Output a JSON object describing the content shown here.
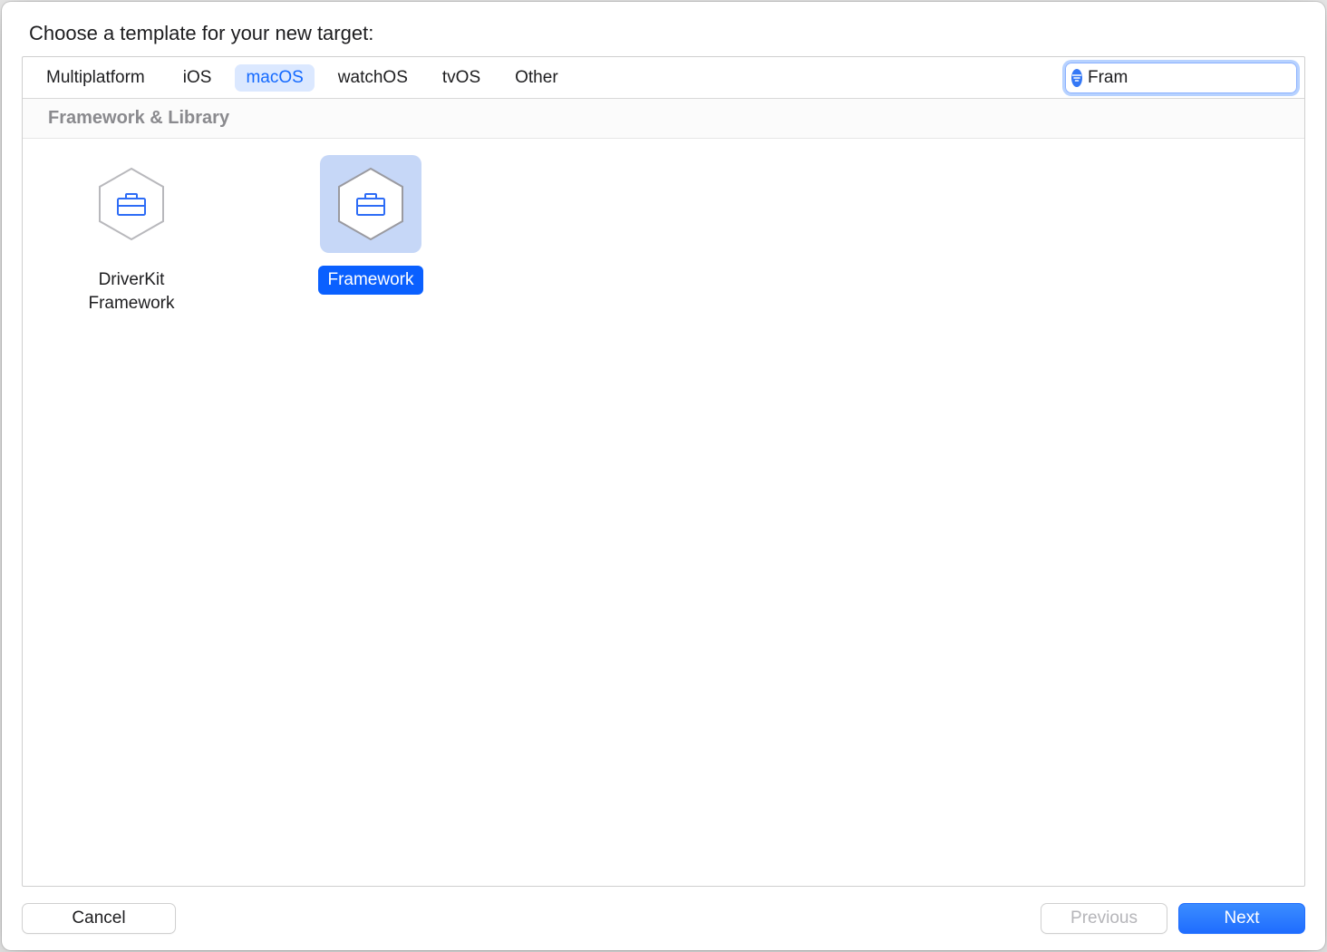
{
  "title": "Choose a template for your new target:",
  "tabs": [
    {
      "id": "multiplatform",
      "label": "Multiplatform",
      "selected": false
    },
    {
      "id": "ios",
      "label": "iOS",
      "selected": false
    },
    {
      "id": "macos",
      "label": "macOS",
      "selected": true
    },
    {
      "id": "watchos",
      "label": "watchOS",
      "selected": false
    },
    {
      "id": "tvos",
      "label": "tvOS",
      "selected": false
    },
    {
      "id": "other",
      "label": "Other",
      "selected": false
    }
  ],
  "search": {
    "value": "Fram",
    "placeholder": "Filter"
  },
  "section": {
    "header": "Framework & Library"
  },
  "templates": [
    {
      "id": "driverkit-framework",
      "label": "DriverKit\nFramework",
      "selected": false
    },
    {
      "id": "framework",
      "label": "Framework",
      "selected": true
    }
  ],
  "buttons": {
    "cancel": "Cancel",
    "previous": "Previous",
    "next": "Next"
  }
}
